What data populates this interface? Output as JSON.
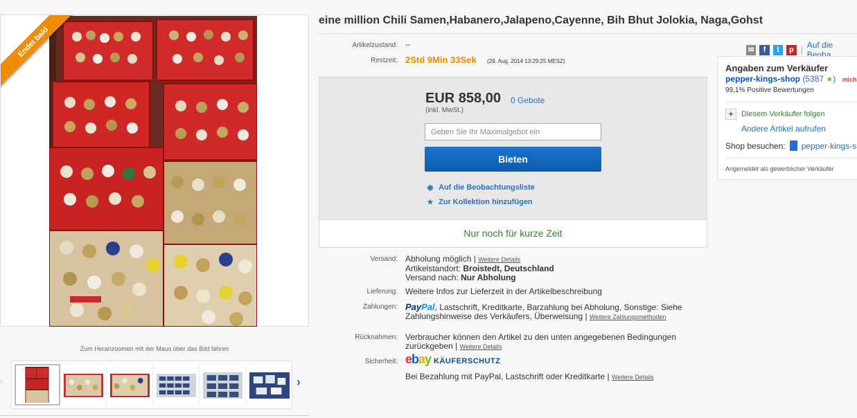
{
  "gallery": {
    "ribbon": "Endet bald",
    "zoom_hint": "Zum Heranzoomen mit der Maus über das Bild fahren",
    "prev_arrow": "‹",
    "next_arrow": "›",
    "thumbnails": [
      "thumbnail-crates-1",
      "thumbnail-jars-2",
      "thumbnail-jars-3",
      "thumbnail-drawers-4",
      "thumbnail-drawers-5",
      "thumbnail-bags-6"
    ]
  },
  "item": {
    "title": "eine million Chili Samen,Habanero,Jalapeno,Cayenne, Bih Bhut Jolokia, Naga,Gohst"
  },
  "details": {
    "condition_label": "Artikelzustand:",
    "condition_value": "--",
    "time_label": "Restzeit:",
    "time_left": "2Std 9Min 33Sek",
    "end_time": "(29. Aug. 2014   13:29:25 MESZ)"
  },
  "share": {
    "separator": "|",
    "watch_link": "Auf die Beoba"
  },
  "bid": {
    "price": "EUR 858,00",
    "bids": "0 Gebote",
    "vat": "(inkl. MwSt.)",
    "max_bid_placeholder": "Geben Sie Ihr Maximalgebot ein",
    "bid_button": "Bieten",
    "watchlist_link": "Auf die Beobachtungsliste",
    "collection_link": "Zur Kollektion hinzufügen",
    "urgency": "Nur noch für kurze Zeit"
  },
  "shipping": {
    "label": "Versand:",
    "value": "Abholung möglich |",
    "details_link": "Weitere Details",
    "location_label": "Artikelstandort:",
    "location_value": "Broistedt, Deutschland",
    "ships_to_label": "Versand nach:",
    "ships_to_value": "Nur Abholung"
  },
  "delivery": {
    "label": "Lieferung:",
    "value": "Weitere Infos zur Lieferzeit in der Artikelbeschreibung"
  },
  "payments": {
    "label": "Zahlungen:",
    "paypal_a": "Pay",
    "paypal_b": "Pal",
    "methods_line1": ", Lastschrift,  Kreditkarte,  Barzahlung bei Abholung,  Sonstige: Siehe",
    "methods_line2": "Zahlungshinweise des Verkäufers,  Überweisung  |",
    "more_link": "Weitere Zahlungsmethoden"
  },
  "returns": {
    "label": "Rücknahmen:",
    "line1": "Verbraucher können den Artikel zu den unten angegebenen Bedingungen",
    "line2": "zurückgeben |",
    "details_link": "Weitere Details"
  },
  "security": {
    "label": "Sicherheit:",
    "ebay_e": "e",
    "ebay_b": "b",
    "ebay_a": "a",
    "ebay_y": "y",
    "protection": "KÄUFERSCHUTZ",
    "text": "Bei Bezahlung mit PayPal, Lastschrift oder Kreditkarte |",
    "details_link": "Weitere Details"
  },
  "seller": {
    "heading": "Angaben zum Verkäufer",
    "name": "pepper-kings-shop",
    "score": "(5387",
    "star": "★",
    "score_close": ")",
    "me_badge": "mich",
    "feedback": "99,1% Positive Bewertungen",
    "follow": "Diesem Verkäufer folgen",
    "follow_icon": "+",
    "other_items": "Andere Artikel aufrufen",
    "shop_label": "Shop besuchen:",
    "shop_link": "pepper-kings-sh",
    "commercial": "Angemeldet als gewerblicher Verkäufer"
  },
  "colors": {
    "accent_orange": "#f18c00",
    "link_blue": "#2670c4",
    "bid_button_blue": "#0c5bb0",
    "urgency_green": "#2b8a25"
  }
}
